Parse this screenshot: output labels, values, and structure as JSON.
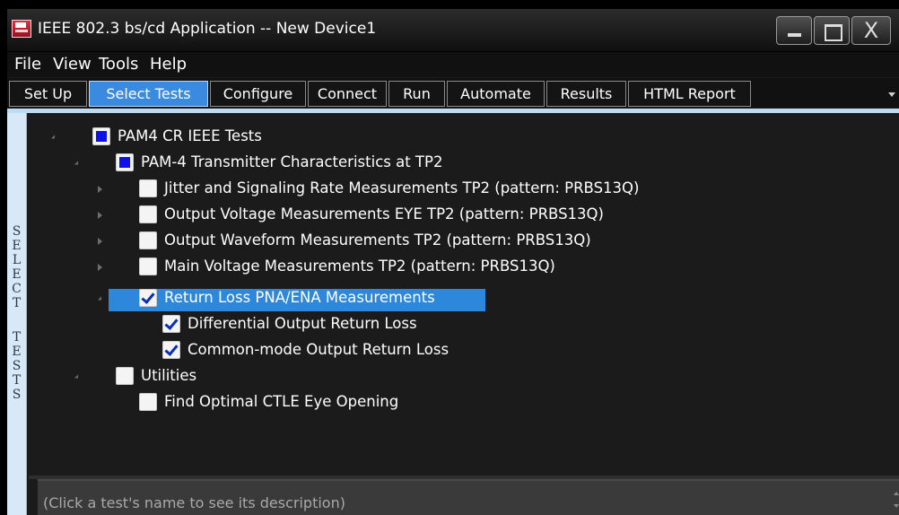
{
  "window": {
    "title": "IEEE 802.3 bs/cd Application -- New Device1",
    "close_glyph": "X"
  },
  "menu": [
    "File",
    "View",
    "Tools",
    "Help"
  ],
  "tabs": [
    {
      "label": "Set Up",
      "active": false
    },
    {
      "label": "Select Tests",
      "active": true
    },
    {
      "label": "Configure",
      "active": false
    },
    {
      "label": "Connect",
      "active": false
    },
    {
      "label": "Run",
      "active": false
    },
    {
      "label": "Automate",
      "active": false
    },
    {
      "label": "Results",
      "active": false
    },
    {
      "label": "HTML Report",
      "active": false
    }
  ],
  "sidebar": {
    "label": "SELECT TESTS"
  },
  "tree": [
    {
      "label": "PAM4 CR IEEE Tests",
      "state": "partial",
      "expander": "open",
      "selected": false
    },
    {
      "label": "PAM-4 Transmitter Characteristics at TP2",
      "state": "partial",
      "expander": "open",
      "selected": false
    },
    {
      "label": "Jitter and Signaling Rate Measurements TP2 (pattern: PRBS13Q)",
      "state": "unchecked",
      "expander": "collapsed",
      "selected": false
    },
    {
      "label": "Output Voltage Measurements EYE TP2 (pattern: PRBS13Q)",
      "state": "unchecked",
      "expander": "collapsed",
      "selected": false
    },
    {
      "label": "Output Waveform Measurements TP2 (pattern: PRBS13Q)",
      "state": "unchecked",
      "expander": "collapsed",
      "selected": false
    },
    {
      "label": "Main Voltage Measurements TP2 (pattern: PRBS13Q)",
      "state": "unchecked",
      "expander": "collapsed",
      "selected": false
    },
    {
      "label": "Return Loss PNA/ENA Measurements",
      "state": "checked",
      "expander": "open",
      "selected": true
    },
    {
      "label": "Differential Output Return Loss",
      "state": "checked",
      "expander": "none",
      "selected": false
    },
    {
      "label": "Common-mode Output Return Loss",
      "state": "checked",
      "expander": "none",
      "selected": false
    },
    {
      "label": "Utilities",
      "state": "unchecked",
      "expander": "open",
      "selected": false
    },
    {
      "label": "Find Optimal CTLE Eye Opening",
      "state": "unchecked",
      "expander": "none",
      "selected": false
    }
  ],
  "description": "(Click a test's name to see its description)",
  "colors": {
    "selection": "#2d88dc",
    "active_tab": "#3a8ae0",
    "partial_fill": "#1010e8",
    "checkmark": "#0a2fb5"
  }
}
